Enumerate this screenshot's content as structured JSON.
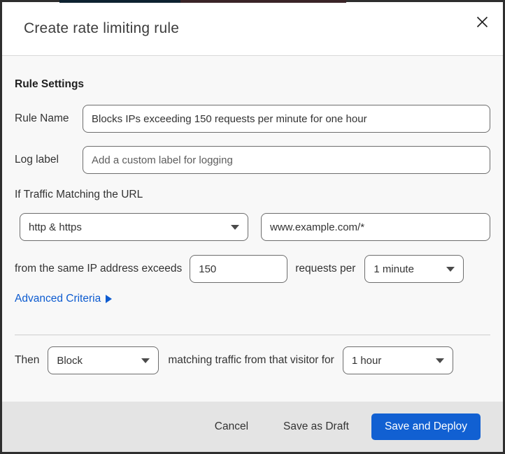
{
  "header": {
    "title": "Create rate limiting rule"
  },
  "body": {
    "section_heading": "Rule Settings",
    "rule_name_label": "Rule Name",
    "rule_name_value": "Blocks IPs exceeding 150 requests per minute for one hour",
    "log_label_label": "Log label",
    "log_label_placeholder": "Add a custom label for logging",
    "match_intro": "If Traffic Matching the URL",
    "scheme_value": "http & https",
    "url_value": "www.example.com/*",
    "threshold_prefix": "from the same IP address exceeds",
    "threshold_value": "150",
    "threshold_suffix": "requests per",
    "period_value": "1 minute",
    "advanced_link_label": "Advanced Criteria",
    "then_label": "Then",
    "action_value": "Block",
    "action_middle": "matching traffic from that visitor for",
    "duration_value": "1 hour"
  },
  "footer": {
    "cancel_label": "Cancel",
    "save_draft_label": "Save as Draft",
    "save_deploy_label": "Save and Deploy"
  },
  "colors": {
    "primary_blue": "#1160d2",
    "link_blue": "#0d5bd0"
  }
}
